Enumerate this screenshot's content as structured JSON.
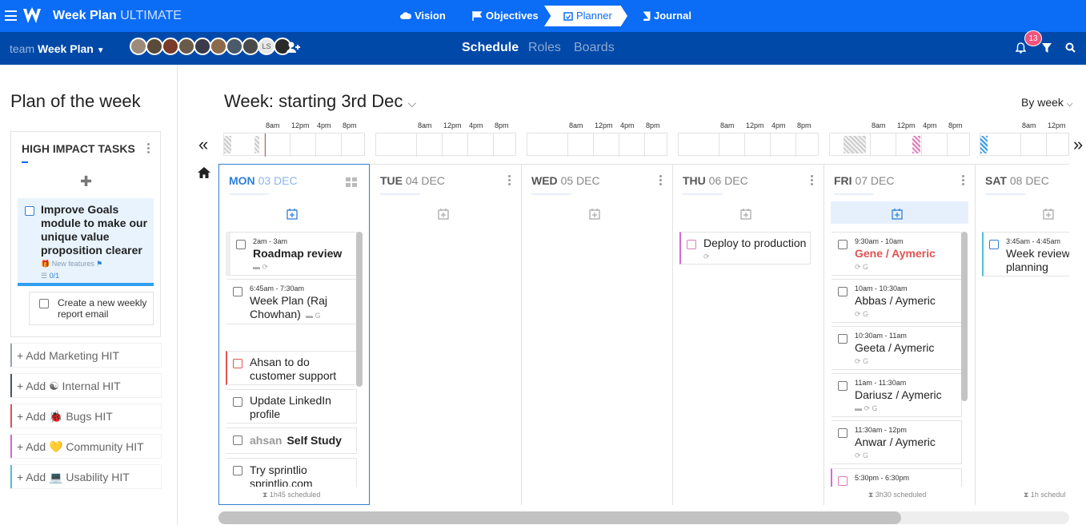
{
  "app": {
    "title_main": "Week Plan",
    "title_tier": "ULTIMATE"
  },
  "nav": {
    "vision": "Vision",
    "objectives": "Objectives",
    "planner": "Planner",
    "journal": "Journal"
  },
  "team": {
    "prefix": "team",
    "name": "Week Plan",
    "avatar_initials": "LS"
  },
  "subtabs": {
    "schedule": "Schedule",
    "roles": "Roles",
    "boards": "Boards"
  },
  "notifications": {
    "count": "13"
  },
  "left": {
    "title": "Plan of the week",
    "hit_header": "HIGH IMPACT TASKS",
    "goal": {
      "text": "Improve Goals module to make our unique value proposition clearer",
      "tag": "New features",
      "progress": "0/1"
    },
    "subtask": "Create a new weekly report email",
    "add_hits": [
      {
        "label": "+ Add Marketing HIT",
        "color": "#9aa4b0"
      },
      {
        "label": "+ Add ☯ Internal HIT",
        "color": "#4a5568"
      },
      {
        "label": "+ Add 🐞 Bugs HIT",
        "color": "#e05353"
      },
      {
        "label": "+ Add 💛 Community HIT",
        "color": "#d46bd4"
      },
      {
        "label": "+ Add 💻 Usability HIT",
        "color": "#4fc1d4"
      }
    ]
  },
  "week": {
    "title": "Week: starting 3rd Dec",
    "view": "By week"
  },
  "timeline": {
    "hours": [
      "8am",
      "12pm",
      "4pm",
      "8pm"
    ]
  },
  "days": [
    {
      "dow": "MON",
      "date": "03 DEC",
      "scheduled": "1h45 scheduled"
    },
    {
      "dow": "TUE",
      "date": "04 DEC"
    },
    {
      "dow": "WED",
      "date": "05 DEC"
    },
    {
      "dow": "THU",
      "date": "06 DEC"
    },
    {
      "dow": "FRI",
      "date": "07 DEC",
      "scheduled": "3h30 scheduled"
    },
    {
      "dow": "SAT",
      "date": "08 DEC",
      "scheduled": "1h schedul"
    }
  ],
  "tasks": {
    "mon": [
      {
        "time": "2am - 3am",
        "title": "Roadmap review"
      },
      {
        "time": "6:45am - 7:30am",
        "title": "Week Plan (Raj Chowhan)"
      },
      {
        "title": "Ahsan to do customer support"
      },
      {
        "title": "Update LinkedIn profile"
      },
      {
        "prefix": "ahsan",
        "title": "Self Study"
      },
      {
        "title": "Try sprintlio sprintlio.com"
      }
    ],
    "thu": [
      {
        "title": "Deploy to production"
      }
    ],
    "fri": [
      {
        "time": "9:30am - 10am",
        "title": "Gene / Aymeric"
      },
      {
        "time": "10am - 10:30am",
        "title": "Abbas / Aymeric"
      },
      {
        "time": "10:30am - 11am",
        "title": "Geeta / Aymeric"
      },
      {
        "time": "11am - 11:30am",
        "title": "Dariusz / Aymeric"
      },
      {
        "time": "11:30am - 12pm",
        "title": "Anwar / Aymeric"
      },
      {
        "time": "5:30pm - 6:30pm"
      }
    ],
    "sat": [
      {
        "time": "3:45am - 4:45am",
        "title": "Week review planning"
      }
    ]
  }
}
